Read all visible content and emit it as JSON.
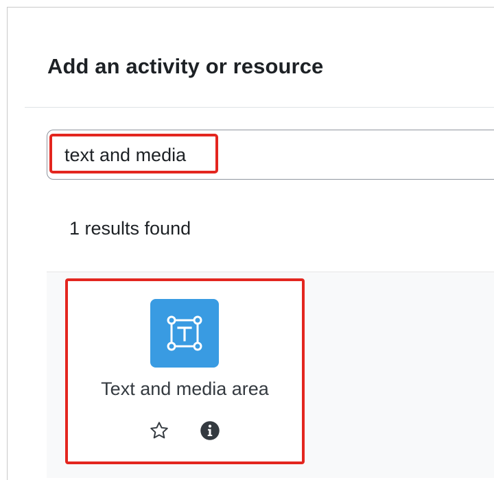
{
  "modal": {
    "title": "Add an activity or resource"
  },
  "search": {
    "value": "text and media",
    "placeholder": "Search"
  },
  "results": {
    "count_text": "1 results found",
    "items": [
      {
        "name": "Text and media area",
        "icon": "text-and-media-area-icon",
        "icon_color": "#399be2",
        "star_icon": "star-outline-icon",
        "info_icon": "info-circle-icon"
      }
    ]
  },
  "colors": {
    "highlight": "#e3261f",
    "panel_bg": "#f8f9fa",
    "text": "#1d2125"
  }
}
